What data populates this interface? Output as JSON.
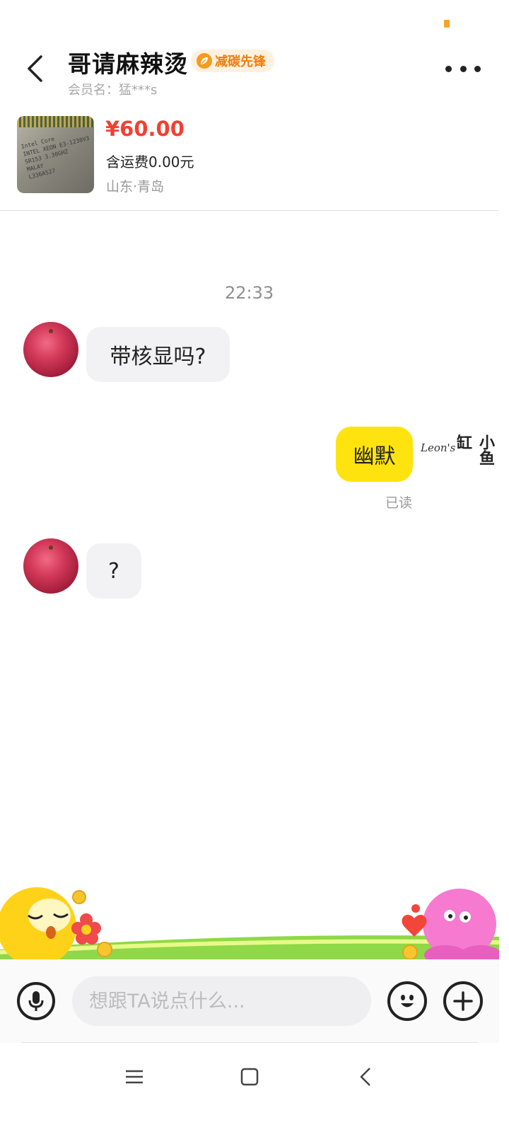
{
  "header": {
    "title": "哥请麻辣烫",
    "badge": "减碳先锋",
    "member_name": "会员名：猛***s",
    "back_icon": "chevron-left-icon",
    "more_icon": "more-dots-icon"
  },
  "product": {
    "price": "¥60.00",
    "shipping": "含运费0.00元",
    "location": "山东·青岛",
    "thumbnail_text": "Intel Core\nINTEL XEON E3-1230V3\nSR153 3.30GHZ\nMALAY\nL336A527"
  },
  "chat": {
    "timestamp": "22:33",
    "messages": [
      {
        "sender": "other",
        "text": "带核显吗?"
      },
      {
        "sender": "self",
        "text": "幽默",
        "status": "已读",
        "avatar_text_1": "Leon's",
        "avatar_text_2": "小鱼缸"
      },
      {
        "sender": "other",
        "text": "?"
      }
    ]
  },
  "input": {
    "placeholder": "想跟TA说点什么..."
  },
  "icons": {
    "voice": "microphone-icon",
    "emoji": "smiley-icon",
    "plus": "plus-icon"
  },
  "nav": {
    "menu": "menu-icon",
    "home": "square-icon",
    "back": "back-icon"
  },
  "colors": {
    "accent_yellow": "#ffe30e",
    "price_red": "#ef4133",
    "badge_orange": "#f07d0a"
  }
}
